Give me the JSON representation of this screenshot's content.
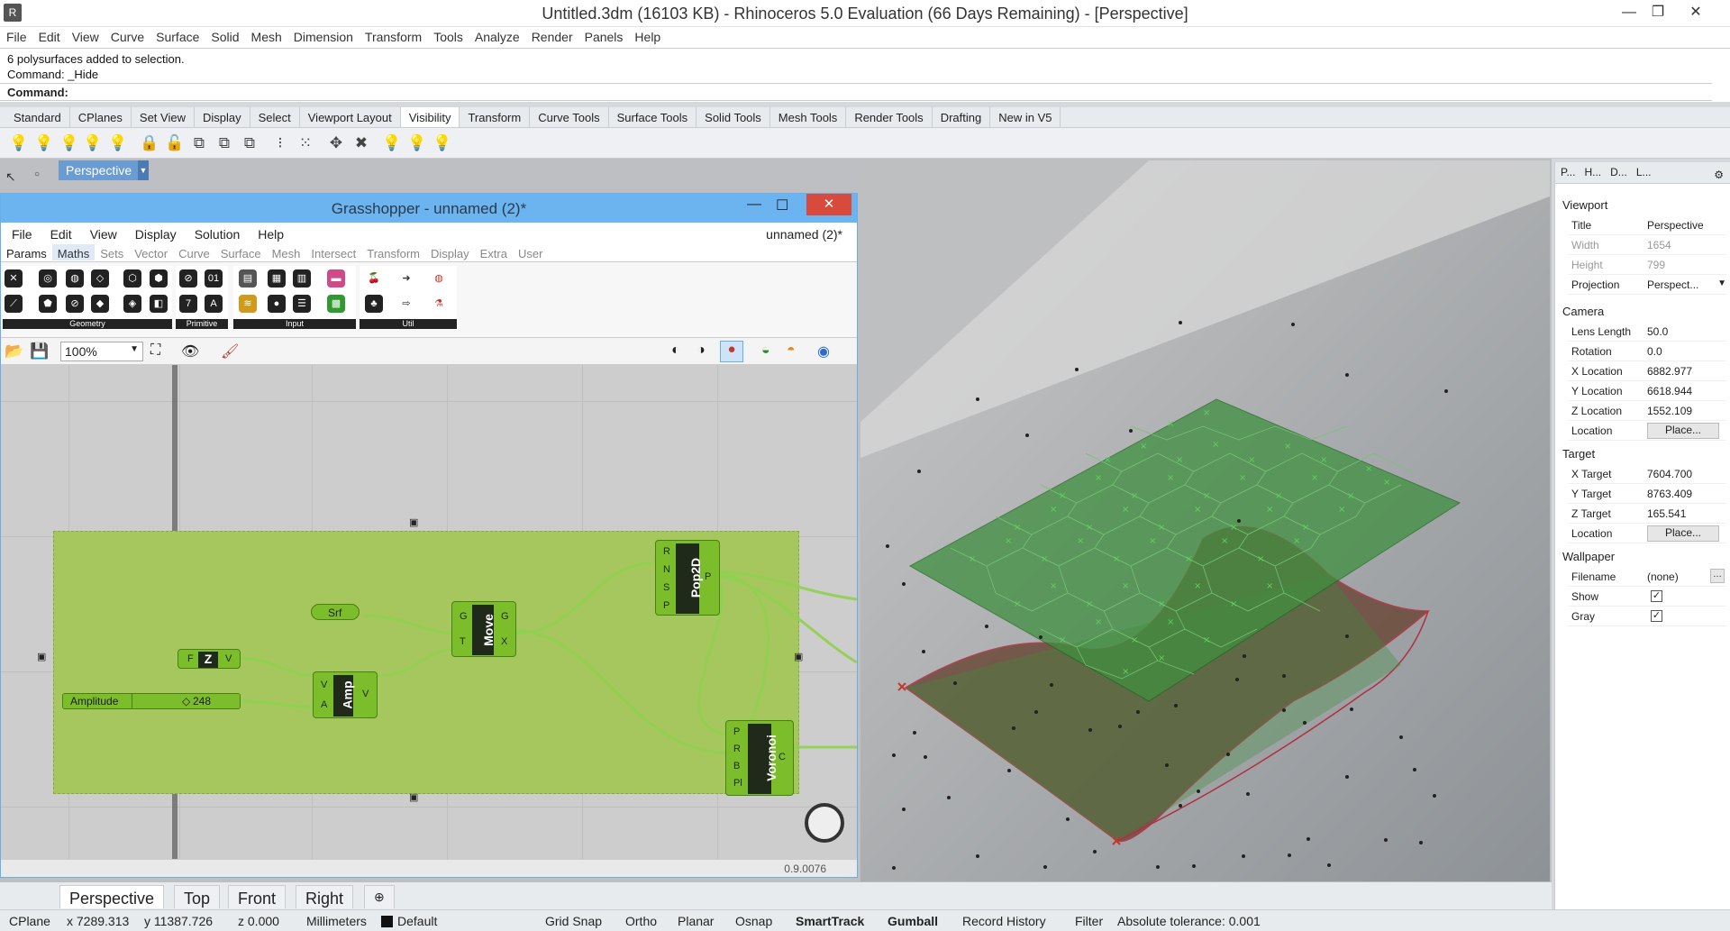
{
  "window": {
    "title": "Untitled.3dm (16103 KB) - Rhinoceros 5.0 Evaluation (66 Days Remaining) - [Perspective]"
  },
  "menu": [
    "File",
    "Edit",
    "View",
    "Curve",
    "Surface",
    "Solid",
    "Mesh",
    "Dimension",
    "Transform",
    "Tools",
    "Analyze",
    "Render",
    "Panels",
    "Help"
  ],
  "command": {
    "history": [
      "6 polysurfaces added to selection.",
      "Command: _Hide"
    ],
    "prompt": "Command:"
  },
  "toolbar_tabs": [
    "Standard",
    "CPlanes",
    "Set View",
    "Display",
    "Select",
    "Viewport Layout",
    "Visibility",
    "Transform",
    "Curve Tools",
    "Surface Tools",
    "Solid Tools",
    "Mesh Tools",
    "Render Tools",
    "Drafting",
    "New in V5"
  ],
  "active_toolbar_tab": "Visibility",
  "viewport": {
    "label": "Perspective"
  },
  "grasshopper": {
    "title": "Grasshopper - unnamed (2)*",
    "menu": [
      "File",
      "Edit",
      "View",
      "Display",
      "Solution",
      "Help"
    ],
    "doc_name": "unnamed (2)*",
    "tabs": [
      "Params",
      "Maths",
      "Sets",
      "Vector",
      "Curve",
      "Surface",
      "Mesh",
      "Intersect",
      "Transform",
      "Display",
      "Extra",
      "User"
    ],
    "active_tab": "Maths",
    "ribbon_groups": [
      "Geometry",
      "Primitive",
      "Input",
      "Util"
    ],
    "zoom": "100%",
    "version": "0.9.0076",
    "components": {
      "srf": "Srf",
      "z": "Z",
      "amp": "Amp",
      "move": "Move",
      "pop2d": "Pop2D",
      "voronoi": "Voronoi",
      "slider_name": "Amplitude",
      "slider_value": "248"
    },
    "ports": {
      "z_in": "F",
      "z_out": "V",
      "amp_in": [
        "V",
        "A"
      ],
      "amp_out": "V",
      "move_in": [
        "G",
        "T"
      ],
      "move_out": [
        "G",
        "X"
      ],
      "pop_in": [
        "R",
        "N",
        "S",
        "P"
      ],
      "pop_out": "P",
      "vor_in": [
        "P",
        "R",
        "B",
        "Pl"
      ],
      "vor_out": "C"
    }
  },
  "properties": {
    "tabs": [
      "P...",
      "H...",
      "D...",
      "L..."
    ],
    "viewport_section": "Viewport",
    "title_label": "Title",
    "title": "Perspective",
    "width_label": "Width",
    "width": "1654",
    "height_label": "Height",
    "height": "799",
    "projection_label": "Projection",
    "projection": "Perspect...",
    "camera_section": "Camera",
    "lens_label": "Lens Length",
    "lens": "50.0",
    "rotation_label": "Rotation",
    "rotation": "0.0",
    "xloc_label": "X Location",
    "xloc": "6882.977",
    "yloc_label": "Y Location",
    "yloc": "6618.944",
    "zloc_label": "Z Location",
    "zloc": "1552.109",
    "location_label": "Location",
    "place_button": "Place...",
    "target_section": "Target",
    "xt_label": "X Target",
    "xt": "7604.700",
    "yt_label": "Y Target",
    "yt": "8763.409",
    "zt_label": "Z Target",
    "zt": "165.541",
    "tloc_label": "Location",
    "tplace_button": "Place...",
    "wallpaper_section": "Wallpaper",
    "filename_label": "Filename",
    "filename": "(none)",
    "show_label": "Show",
    "gray_label": "Gray"
  },
  "viewport_tabs": [
    "Perspective",
    "Top",
    "Front",
    "Right"
  ],
  "statusbar": {
    "cplane": "CPlane",
    "x": "x 7289.313",
    "y": "y 11387.726",
    "z": "z 0.000",
    "units": "Millimeters",
    "layer": "Default",
    "grid_snap": "Grid Snap",
    "ortho": "Ortho",
    "planar": "Planar",
    "osnap": "Osnap",
    "smarttrack": "SmartTrack",
    "gumball": "Gumball",
    "record_history": "Record History",
    "filter": "Filter",
    "tolerance": "Absolute tolerance: 0.001"
  },
  "colors": {
    "accent": "#6cb4f0",
    "gh_group": "#a6c75e",
    "component": "#7cbd2b",
    "close": "#d84a3c"
  }
}
